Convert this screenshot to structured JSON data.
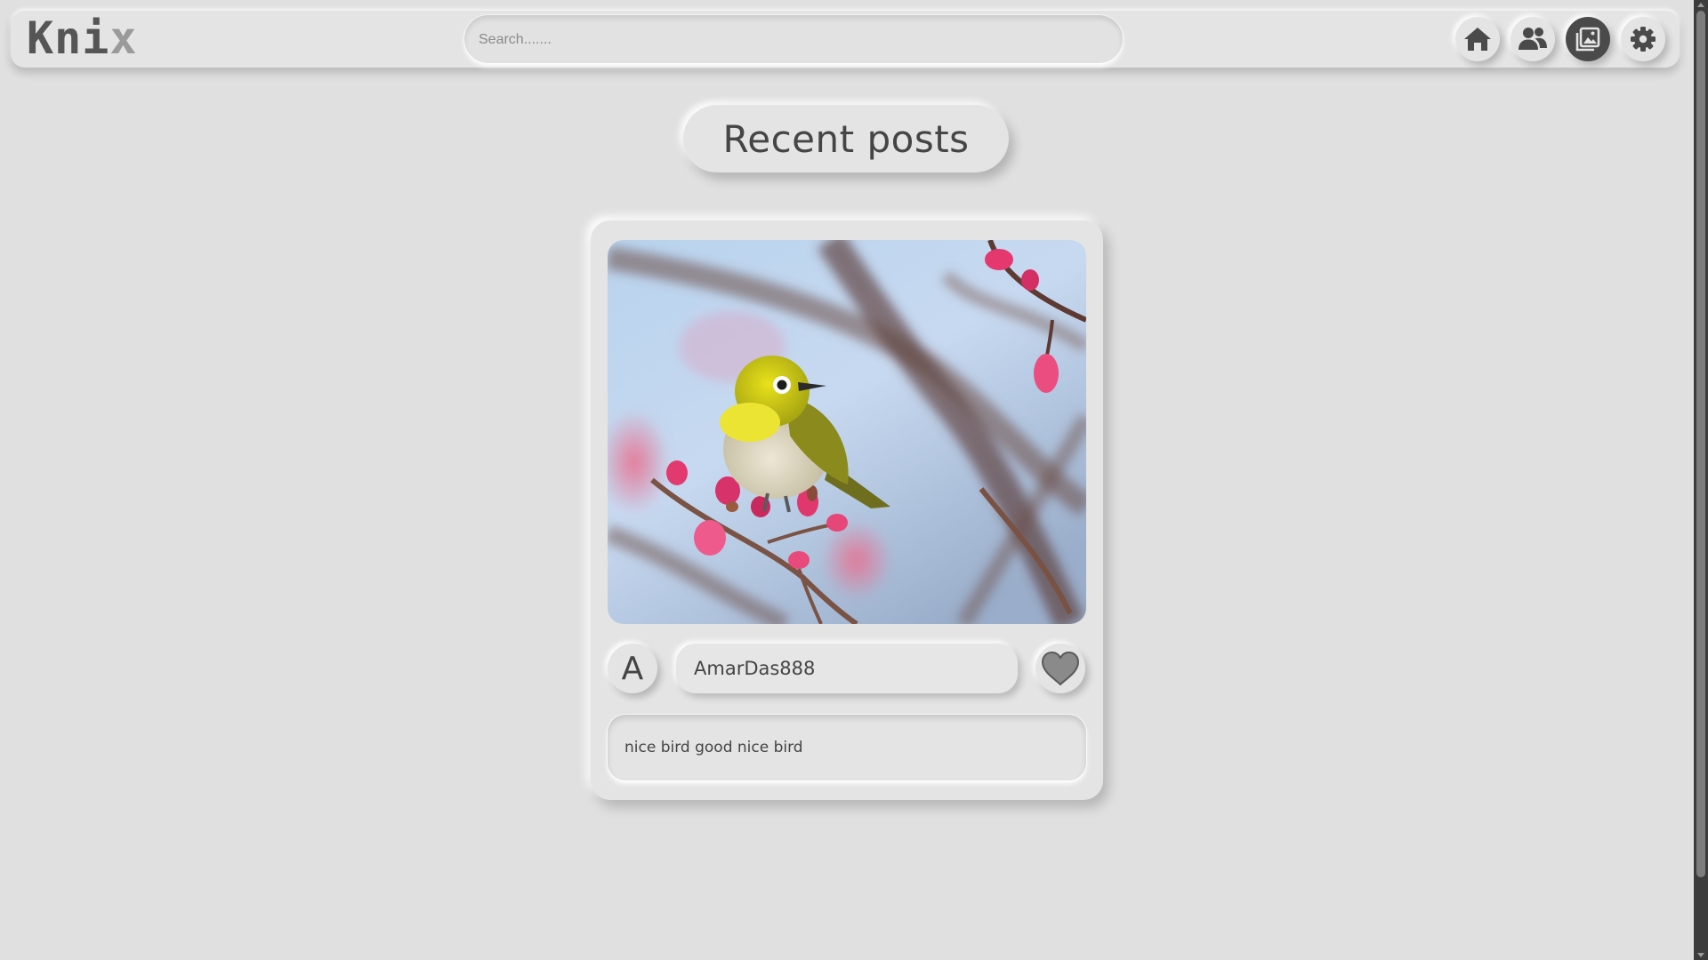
{
  "app": {
    "logo_part1": "Kni",
    "logo_part2": "x"
  },
  "search": {
    "placeholder": "Search.......",
    "value": ""
  },
  "nav": {
    "buttons": [
      {
        "name": "home",
        "icon": "home-icon",
        "active": false
      },
      {
        "name": "friends",
        "icon": "people-icon",
        "active": false
      },
      {
        "name": "posts",
        "icon": "image-gallery-icon",
        "active": true
      },
      {
        "name": "settings",
        "icon": "gear-icon",
        "active": false
      }
    ]
  },
  "main": {
    "heading": "Recent posts"
  },
  "post": {
    "image_icon": "bird-on-branch-photo",
    "avatar_letter": "A",
    "username": "AmarDas888",
    "like_icon": "heart-icon",
    "caption": "nice bird good nice bird"
  },
  "colors": {
    "background": "#e0e0e0",
    "text": "#444444",
    "active_nav": "#4a4a4a",
    "logo_dark": "#555555",
    "logo_light": "#9a9a9a"
  }
}
